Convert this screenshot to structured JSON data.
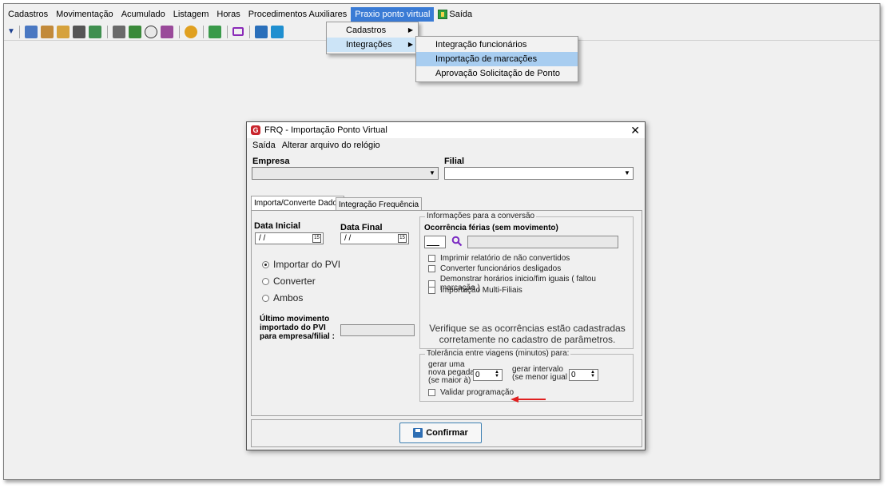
{
  "menubar": {
    "items": [
      {
        "label": "Cadastros"
      },
      {
        "label": "Movimentação"
      },
      {
        "label": "Acumulado"
      },
      {
        "label": "Listagem"
      },
      {
        "label": "Horas"
      },
      {
        "label": "Procedimentos Auxiliares"
      },
      {
        "label": "Praxio ponto virtual"
      },
      {
        "label": "Saída"
      }
    ]
  },
  "submenu_level1": {
    "items": [
      {
        "label": "Cadastros",
        "has_submenu": true
      },
      {
        "label": "Integrações",
        "has_submenu": true
      }
    ]
  },
  "submenu_level2": {
    "items": [
      {
        "label": "Integração funcionários"
      },
      {
        "label": "Importação de marcações"
      },
      {
        "label": "Aprovação Solicitação de Ponto"
      }
    ]
  },
  "dialog": {
    "title": "FRQ - Importação Ponto Virtual",
    "menu": [
      "Saída",
      "Alterar arquivo do relógio"
    ],
    "empresa_label": "Empresa",
    "empresa_value": "",
    "filial_label": "Filial",
    "filial_value": "",
    "tabs": [
      "Importa/Converte Dados",
      "Integração Frequência"
    ],
    "data_inicial_label": "Data Inicial",
    "data_inicial_value": "/ /",
    "data_final_label": "Data Final",
    "data_final_value": "/ /",
    "radio_options": [
      {
        "label": "Importar do PVI",
        "selected": true
      },
      {
        "label": "Converter",
        "selected": false
      },
      {
        "label": "Ambos",
        "selected": false
      }
    ],
    "ultimo_movimento_label": "Último movimento importado do PVI para empresa/filial :",
    "ultimo_movimento_lines": [
      "Último movimento",
      "importado do PVI",
      "para empresa/filial :"
    ],
    "ultimo_movimento_value": "",
    "info_group_title": "Informações para a conversão",
    "ocorrencia_label": "Ocorrência férias (sem movimento)",
    "ocorrencia_code": "",
    "ocorrencia_desc": "",
    "checkboxes": [
      {
        "label": "Imprimir relatório de não convertidos",
        "checked": false
      },
      {
        "label": "Converter funcionários desligados",
        "checked": false
      },
      {
        "label": "Demonstrar horários inicio/fim iguais ( faltou marcação )",
        "checked": false
      },
      {
        "label": "Importação Multi-Filiais",
        "checked": false
      }
    ],
    "info_message_lines": [
      "Verifique se as ocorrências estão cadastradas",
      "corretamente  no cadastro de parâmetros."
    ],
    "tolerancia_group_title": "Tolerância entre viagens (minutos) para:",
    "gerar_nova_pegada_lines": [
      "gerar uma",
      "nova pegada",
      "(se maior à)"
    ],
    "gerar_nova_pegada_value": "0",
    "gerar_intervalo_lines": [
      "gerar intervalo",
      "(se menor igual à)"
    ],
    "gerar_intervalo_value": "0",
    "validar_programacao_label": "Validar programação",
    "validar_programacao_checked": false,
    "confirm_label": "Confirmar"
  },
  "colors": {
    "menu_active": "#3a7bd5",
    "menu_highlight": "#a8cdf0",
    "annotation_arrow": "#e02020",
    "logo_red": "#c9252c"
  }
}
